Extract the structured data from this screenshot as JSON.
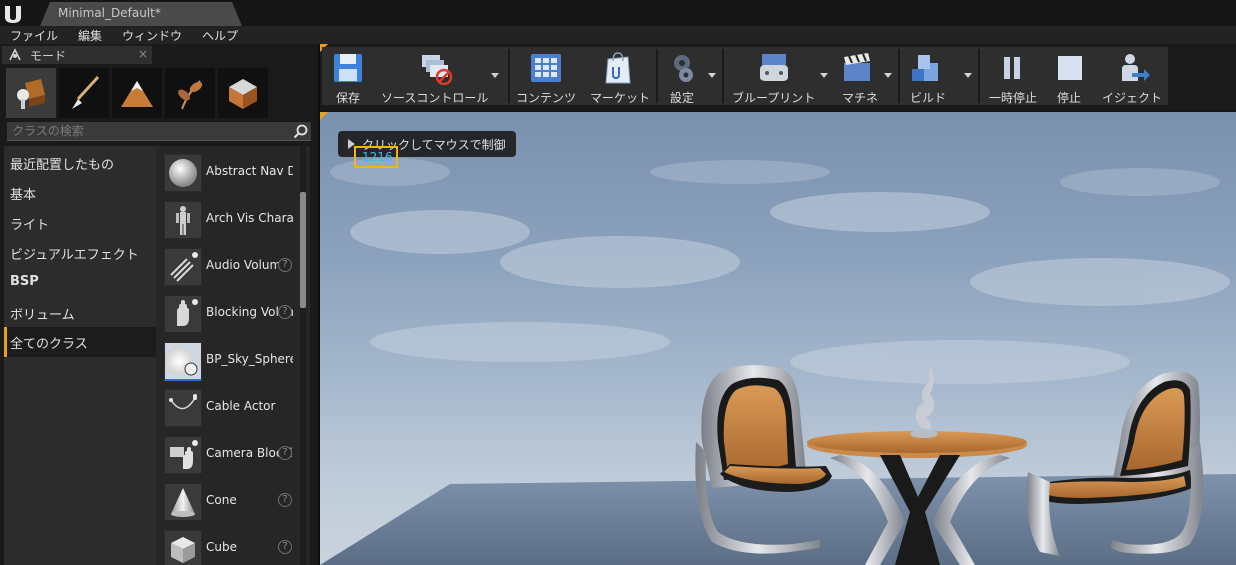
{
  "window": {
    "doc_tab": "Minimal_Default*"
  },
  "menu": [
    "ファイル",
    "編集",
    "ウィンドウ",
    "ヘルプ"
  ],
  "mode_panel": {
    "tab_label": "モード",
    "tab_close": "×",
    "search_placeholder": "クラスの検索",
    "categories": [
      {
        "label": "最近配置したもの"
      },
      {
        "label": "基本"
      },
      {
        "label": "ライト"
      },
      {
        "label": "ビジュアルエフェクト"
      },
      {
        "label": "BSP"
      },
      {
        "label": "ボリューム"
      },
      {
        "label": "全てのクラス"
      }
    ],
    "selected_category": "全てのクラス",
    "classes": [
      {
        "name": "Abstract Nav Data",
        "icon": "sphere-icon"
      },
      {
        "name": "Arch Vis Character",
        "icon": "character-icon"
      },
      {
        "name": "Audio Volume",
        "icon": "audio-volume-icon"
      },
      {
        "name": "Blocking Volume",
        "icon": "blocking-volume-icon"
      },
      {
        "name": "BP_Sky_Sphere",
        "icon": "sky-sphere-icon"
      },
      {
        "name": "Cable Actor",
        "icon": "cable-icon"
      },
      {
        "name": "Camera Blocking Volume",
        "icon": "camera-blocking-icon"
      },
      {
        "name": "Cone",
        "icon": "cone-icon"
      },
      {
        "name": "Cube",
        "icon": "cube-icon"
      }
    ],
    "help_glyph": "?"
  },
  "toolbar": {
    "save": "保存",
    "source_control": "ソースコントロール",
    "content": "コンテンツ",
    "market": "マーケット",
    "settings": "設定",
    "blueprint": "ブループリント",
    "matinee": "マチネ",
    "build": "ビルド",
    "pause": "一時停止",
    "stop": "停止",
    "eject": "イジェクト"
  },
  "viewport": {
    "hint": "クリックしてマウスで制御",
    "fps": "1216"
  },
  "colors": {
    "accent": "#e5a01d",
    "highlight_box": "#f1b80b",
    "fps_text": "#3fb5e8",
    "selection_blue": "#2b6fd6"
  }
}
